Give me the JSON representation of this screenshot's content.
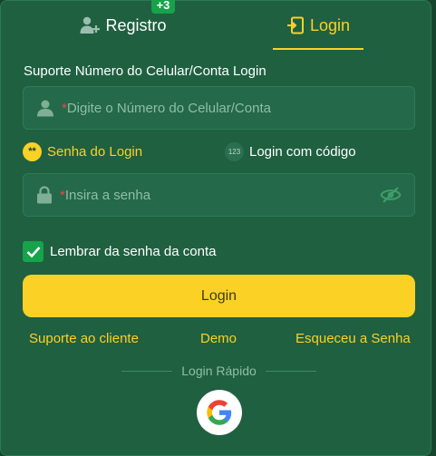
{
  "tabs": {
    "register_label": "Registro",
    "register_badge": "+3",
    "login_label": "Login"
  },
  "form": {
    "account_label": "Suporte Número do Celular/Conta Login",
    "phone_placeholder_required": "*",
    "phone_placeholder": "Digite o Número do Celular/Conta",
    "mode_password": "Senha do Login",
    "mode_password_icon_text": "**",
    "mode_code": "Login com código",
    "mode_code_icon_text": "123",
    "password_placeholder_required": "*",
    "password_placeholder": "Insira a senha",
    "remember_label": "Lembrar da senha da conta",
    "remember_checked": true,
    "login_button": "Login"
  },
  "links": {
    "support": "Suporte ao cliente",
    "demo": "Demo",
    "forgot": "Esqueceu a Senha"
  },
  "quick_login": {
    "label": "Login Rápido",
    "providers": [
      "google-icon"
    ]
  },
  "colors": {
    "background": "#1f6040",
    "accent": "#fbd126",
    "check": "#16a34a"
  }
}
